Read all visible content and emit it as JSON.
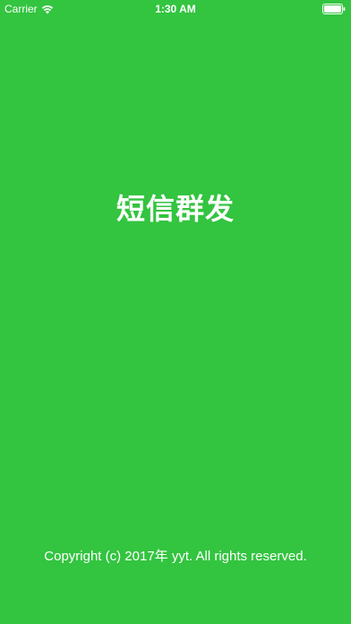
{
  "status_bar": {
    "carrier": "Carrier",
    "time": "1:30 AM",
    "wifi_icon": "wifi-icon",
    "battery_icon": "battery-icon"
  },
  "splash": {
    "title": "短信群发",
    "copyright": "Copyright (c) 2017年 yyt. All rights reserved."
  },
  "colors": {
    "background": "#33c440",
    "text": "#ffffff"
  }
}
